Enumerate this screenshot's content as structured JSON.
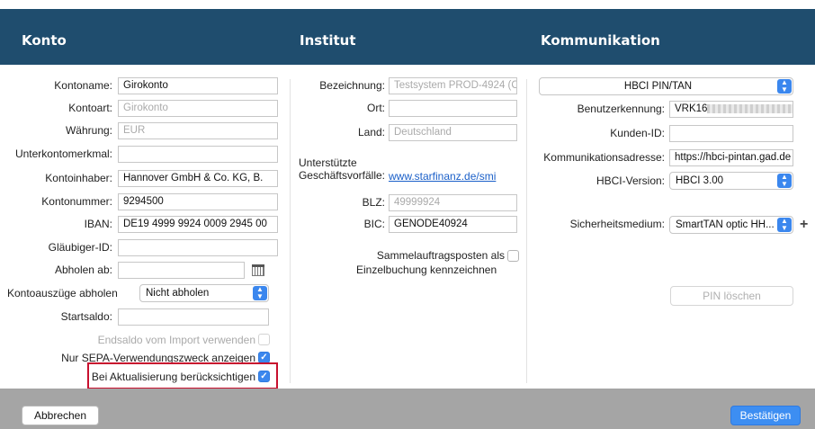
{
  "header": {
    "konto": "Konto",
    "institut": "Institut",
    "kommunikation": "Kommunikation"
  },
  "konto": {
    "kontoname_label": "Kontoname:",
    "kontoname_value": "Girokonto",
    "kontoart_label": "Kontoart:",
    "kontoart_placeholder": "Girokonto",
    "waehrung_label": "Währung:",
    "waehrung_placeholder": "EUR",
    "unterkontomerkmal_label": "Unterkontomerkmal:",
    "unterkontomerkmal_value": "",
    "kontoinhaber_label": "Kontoinhaber:",
    "kontoinhaber_value": "Hannover GmbH & Co. KG, B.",
    "kontonummer_label": "Kontonummer:",
    "kontonummer_value": "9294500",
    "iban_label": "IBAN:",
    "iban_value": "DE19 4999 9924 0009 2945 00",
    "glaeubiger_label": "Gläubiger-ID:",
    "glaeubiger_value": "",
    "abholen_ab_label": "Abholen ab:",
    "abholen_ab_value": "",
    "kontoauszuege_label": "Kontoauszüge abholen",
    "kontoauszuege_value": "Nicht abholen",
    "startsaldo_label": "Startsaldo:",
    "startsaldo_value": "",
    "endsaldo_label": "Endsaldo vom Import verwenden",
    "nur_sepa_label": "Nur SEPA-Verwendungszweck anzeigen",
    "bei_aktualisierung_label": "Bei Aktualisierung berücksichtigen"
  },
  "institut": {
    "bezeichnung_label": "Bezeichnung:",
    "bezeichnung_placeholder": "Testsystem PROD-4924 (C",
    "ort_label": "Ort:",
    "ort_value": "",
    "land_label": "Land:",
    "land_placeholder": "Deutschland",
    "unterstuetzte_label_1": "Unterstützte",
    "unterstuetzte_label_2": "Geschäftsvorfälle:",
    "unterstuetzte_link": "www.starfinanz.de/smi",
    "blz_label": "BLZ:",
    "blz_placeholder": "49999924",
    "bic_label": "BIC:",
    "bic_value": "GENODE40924",
    "sammel_label_1": "Sammelauftragsposten als",
    "sammel_label_2": "Einzelbuchung kennzeichnen"
  },
  "kommunikation": {
    "verfahren_value": "HBCI PIN/TAN",
    "benutzerkennung_label": "Benutzerkennung:",
    "benutzerkennung_value": "VRK16",
    "kunden_id_label": "Kunden-ID:",
    "kunden_id_value": "",
    "adresse_label": "Kommunikationsadresse:",
    "adresse_value": "https://hbci-pintan.gad.de",
    "hbci_version_label": "HBCI-Version:",
    "hbci_version_value": "HBCI 3.00",
    "sicherheitsmedium_label": "Sicherheitsmedium:",
    "sicherheitsmedium_value": "SmartTAN optic HH...",
    "pin_loeschen": "PIN löschen"
  },
  "footer": {
    "abbrechen": "Abbrechen",
    "bestaetigen": "Bestätigen"
  },
  "colors": {
    "header_bg": "#1f4d6e",
    "accent": "#3b87ee",
    "highlight": "#c8102e",
    "footer_bg": "#a5a5a5"
  }
}
